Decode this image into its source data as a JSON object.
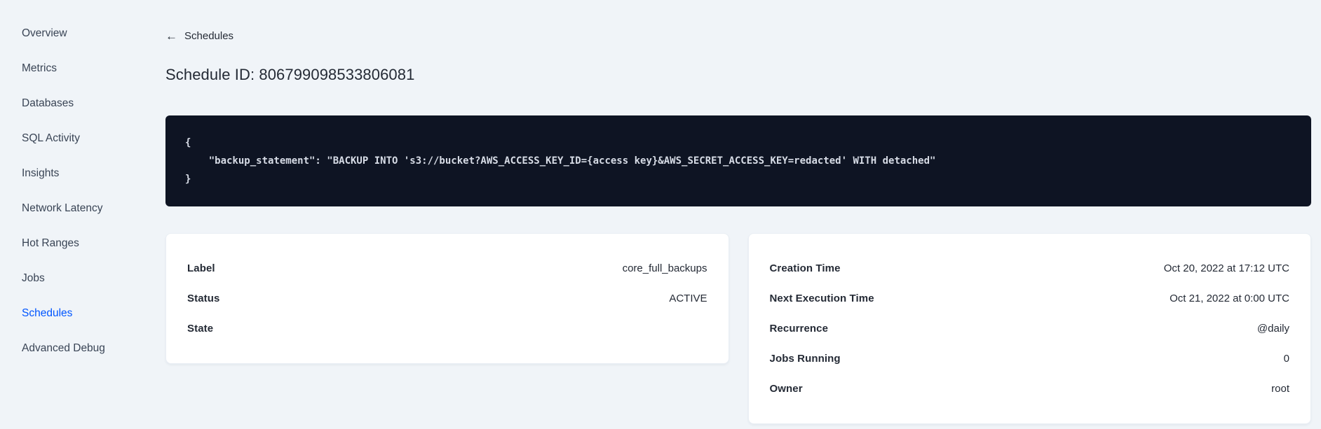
{
  "sidebar": {
    "items": [
      {
        "label": "Overview",
        "active": false
      },
      {
        "label": "Metrics",
        "active": false
      },
      {
        "label": "Databases",
        "active": false
      },
      {
        "label": "SQL Activity",
        "active": false
      },
      {
        "label": "Insights",
        "active": false
      },
      {
        "label": "Network Latency",
        "active": false
      },
      {
        "label": "Hot Ranges",
        "active": false
      },
      {
        "label": "Jobs",
        "active": false
      },
      {
        "label": "Schedules",
        "active": true
      },
      {
        "label": "Advanced Debug",
        "active": false
      }
    ]
  },
  "header": {
    "back_label": "Schedules",
    "back_icon": "arrow-left",
    "title": "Schedule ID: 806799098533806081"
  },
  "code_block": {
    "lines": [
      "{",
      "    \"backup_statement\": \"BACKUP INTO 's3://bucket?AWS_ACCESS_KEY_ID={access key}&AWS_SECRET_ACCESS_KEY=redacted' WITH detached\"",
      "}"
    ]
  },
  "details_card": {
    "rows": [
      {
        "label": "Label",
        "value": "core_full_backups"
      },
      {
        "label": "Status",
        "value": "ACTIVE"
      },
      {
        "label": "State",
        "value": ""
      }
    ]
  },
  "schedule_card": {
    "rows": [
      {
        "label": "Creation Time",
        "value": "Oct 20, 2022 at 17:12 UTC"
      },
      {
        "label": "Next Execution Time",
        "value": "Oct 21, 2022 at 0:00 UTC"
      },
      {
        "label": "Recurrence",
        "value": "@daily"
      },
      {
        "label": "Jobs Running",
        "value": "0"
      },
      {
        "label": "Owner",
        "value": "root"
      }
    ]
  },
  "colors": {
    "page_background": "#f0f4f8",
    "active_link": "#0055ff",
    "code_background": "#0e1423",
    "code_text": "#d7dce6",
    "heading_text": "#242a35",
    "nav_text": "#394455",
    "card_background": "#ffffff"
  }
}
